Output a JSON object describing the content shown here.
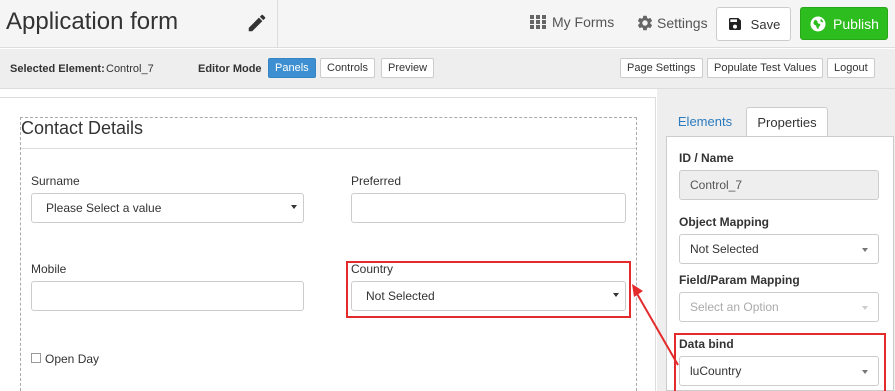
{
  "header": {
    "title": "Application form",
    "my_forms": "My Forms",
    "settings": "Settings",
    "save": "Save",
    "publish": "Publish"
  },
  "toolbar": {
    "selected_label": "Selected Element:",
    "selected_value": "Control_7",
    "editor_mode_label": "Editor Mode",
    "modes": [
      "Panels",
      "Controls",
      "Preview"
    ],
    "active_mode": "Panels",
    "page_settings": "Page Settings",
    "populate": "Populate Test Values",
    "logout": "Logout"
  },
  "form": {
    "panel_title": "Contact Details",
    "surname_label": "Surname",
    "surname_value": "Please Select a value",
    "preferred_label": "Preferred",
    "mobile_label": "Mobile",
    "country_label": "Country",
    "country_value": "Not Selected",
    "open_day_label": "Open Day"
  },
  "properties": {
    "tabs": [
      "Elements",
      "Properties"
    ],
    "active_tab": "Properties",
    "id_label": "ID / Name",
    "id_value": "Control_7",
    "object_mapping_label": "Object Mapping",
    "object_mapping_value": "Not Selected",
    "field_mapping_label": "Field/Param Mapping",
    "field_mapping_placeholder": "Select an Option",
    "data_bind_label": "Data bind",
    "data_bind_value": "luCountry"
  },
  "colors": {
    "publish": "#2ebd1e",
    "active_mode": "#3d8fd1",
    "highlight": "#e32b2b",
    "link": "#2b7bbf"
  }
}
